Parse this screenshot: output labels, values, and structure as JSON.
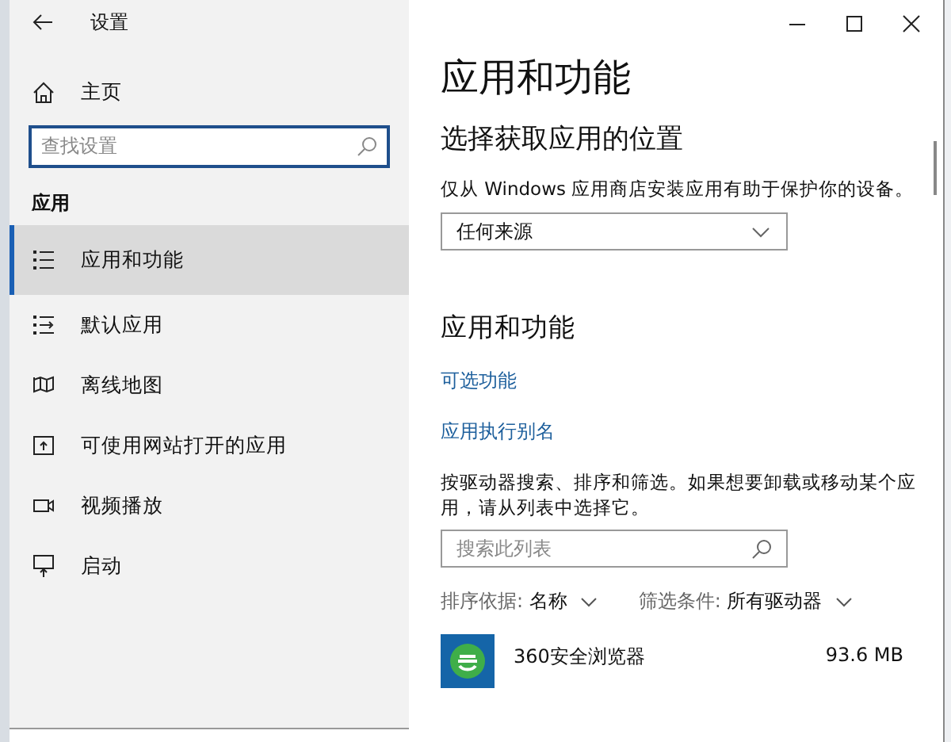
{
  "window": {
    "title": "设置"
  },
  "sidebar": {
    "home": "主页",
    "search": {
      "placeholder": "查找设置"
    },
    "section": "应用",
    "items": [
      {
        "label": "应用和功能",
        "kind": "list",
        "selected": true
      },
      {
        "label": "默认应用",
        "kind": "defaults",
        "selected": false
      },
      {
        "label": "离线地图",
        "kind": "maps",
        "selected": false
      },
      {
        "label": "可使用网站打开的应用",
        "kind": "websites",
        "selected": false
      },
      {
        "label": "视频播放",
        "kind": "video",
        "selected": false
      },
      {
        "label": "启动",
        "kind": "startup",
        "selected": false
      }
    ]
  },
  "main": {
    "title": "应用和功能",
    "subtitle": "选择获取应用的位置",
    "description": "仅从 Windows 应用商店安装应用有助于保护你的设备。",
    "source_dropdown": "任何来源",
    "section": "应用和功能",
    "links": [
      "可选功能",
      "应用执行别名"
    ],
    "instructions": "按驱动器搜索、排序和筛选。如果想要卸载或移动某个应用，请从列表中选择它。",
    "search": {
      "placeholder": "搜索此列表"
    },
    "sort": {
      "label": "排序依据:",
      "value": "名称"
    },
    "filter": {
      "label": "筛选条件:",
      "value": "所有驱动器"
    },
    "apps": [
      {
        "name": "360安全浏览器",
        "size": "93.6 MB"
      }
    ]
  }
}
